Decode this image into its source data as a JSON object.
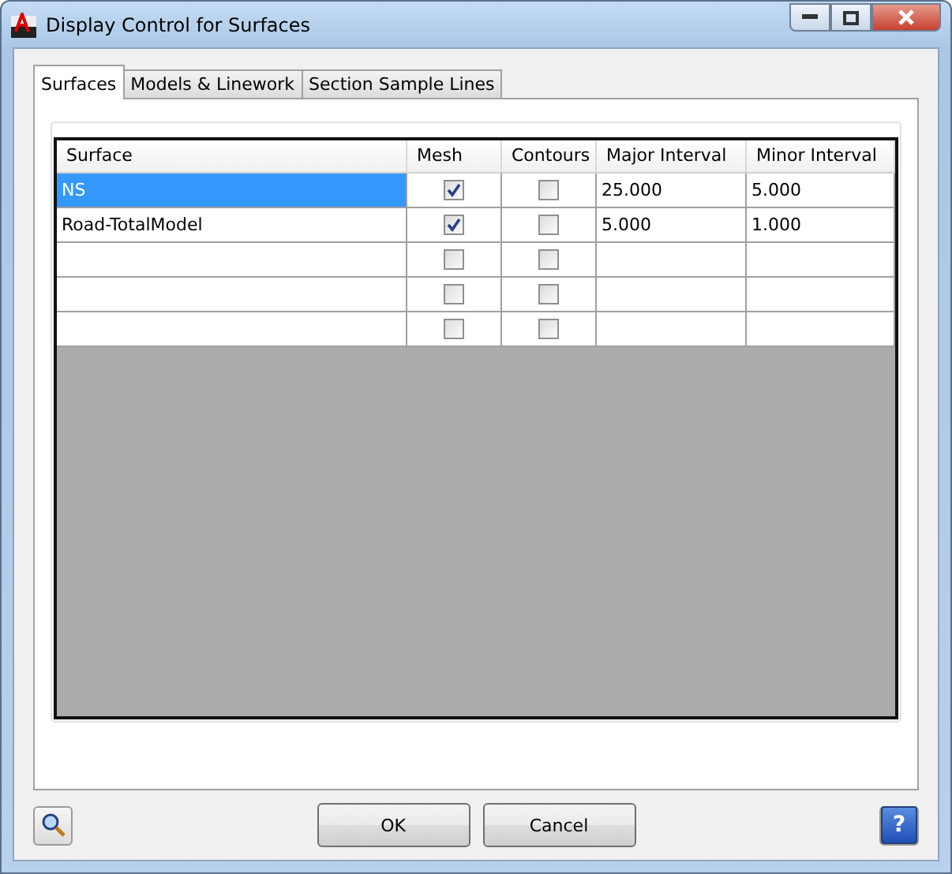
{
  "window": {
    "title": "Display Control for Surfaces"
  },
  "tabs": [
    {
      "label": "Surfaces",
      "selected": true
    },
    {
      "label": "Models & Linework",
      "selected": false
    },
    {
      "label": "Section Sample Lines",
      "selected": false
    }
  ],
  "table": {
    "columns": [
      "Surface",
      "Mesh",
      "Contours",
      "Major Interval",
      "Minor Interval"
    ],
    "rows": [
      {
        "surface": "NS",
        "mesh": true,
        "contours": false,
        "major_interval": "25.000",
        "minor_interval": "5.000",
        "selected": true
      },
      {
        "surface": "Road-TotalModel",
        "mesh": true,
        "contours": false,
        "major_interval": "5.000",
        "minor_interval": "1.000",
        "selected": false
      },
      {
        "mesh": false,
        "contours": false,
        "selected": false
      },
      {
        "mesh": false,
        "contours": false,
        "selected": false
      },
      {
        "mesh": false,
        "contours": false,
        "selected": false
      }
    ]
  },
  "buttons": [
    "OK",
    "Cancel"
  ],
  "help_button": "?"
}
